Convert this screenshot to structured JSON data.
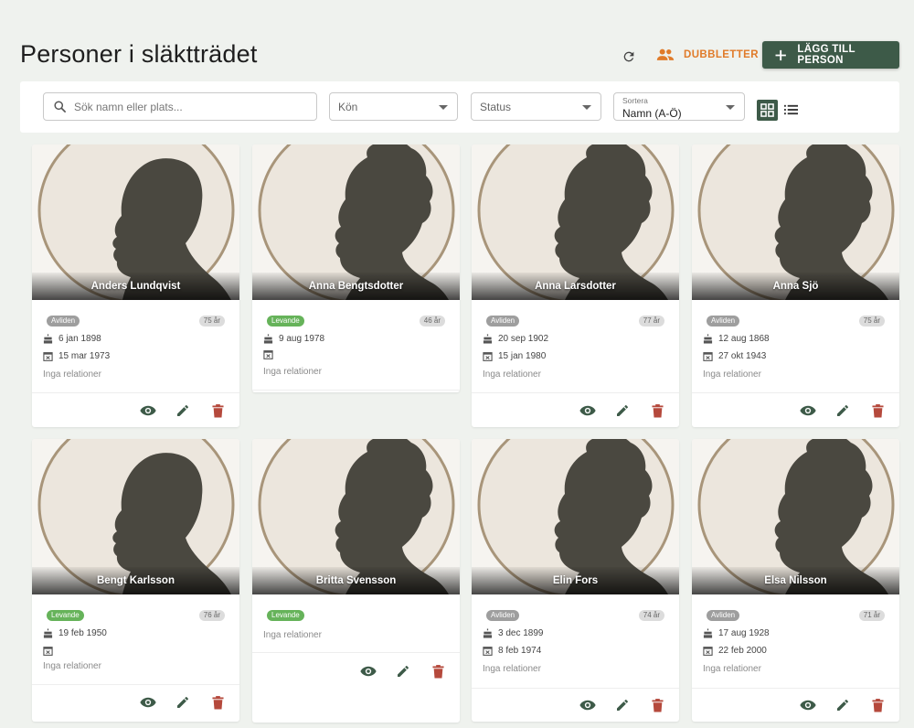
{
  "header": {
    "title": "Personer i släktträdet",
    "duplicates_label": "DUBBLETTER",
    "add_person_label": "LÄGG TILL PERSON"
  },
  "filters": {
    "search_placeholder": "Sök namn eller plats...",
    "gender_label": "Kön",
    "status_label": "Status",
    "sort_label": "Sortera",
    "sort_value": "Namn (A-Ö)"
  },
  "colors": {
    "accent": "#3d5a48",
    "duplicates": "#e07b2a",
    "alive_badge": "#66b35a",
    "deceased_badge": "#9e9e9e",
    "delete_icon": "#b5493c"
  },
  "persons": [
    {
      "name": "Anders Lundqvist",
      "status": "Avliden",
      "alive": false,
      "age": "75 år",
      "birth": "6 jan 1898",
      "death": "15 mar 1973",
      "relations": "Inga relationer",
      "silhouette": "male"
    },
    {
      "name": "Anna Bengtsdotter",
      "status": "Levande",
      "alive": true,
      "age": "46 år",
      "birth": "9 aug 1978",
      "death": "",
      "relations": "Inga relationer",
      "silhouette": "female"
    },
    {
      "name": "Anna Larsdotter",
      "status": "Avliden",
      "alive": false,
      "age": "77 år",
      "birth": "20 sep 1902",
      "death": "15 jan 1980",
      "relations": "Inga relationer",
      "silhouette": "female"
    },
    {
      "name": "Anna Sjö",
      "status": "Avliden",
      "alive": false,
      "age": "75 år",
      "birth": "12 aug 1868",
      "death": "27 okt 1943",
      "relations": "Inga relationer",
      "silhouette": "female"
    },
    {
      "name": "Bengt Karlsson",
      "status": "Levande",
      "alive": true,
      "age": "76 år",
      "birth": "19 feb 1950",
      "death": "",
      "relations": "Inga relationer",
      "silhouette": "male"
    },
    {
      "name": "Britta Svensson",
      "status": "Levande",
      "alive": true,
      "age": "",
      "birth": "",
      "death": "",
      "relations": "Inga relationer",
      "silhouette": "female"
    },
    {
      "name": "Elin Fors",
      "status": "Avliden",
      "alive": false,
      "age": "74 år",
      "birth": "3 dec 1899",
      "death": "8 feb 1974",
      "relations": "Inga relationer",
      "silhouette": "female"
    },
    {
      "name": "Elsa Nilsson",
      "status": "Avliden",
      "alive": false,
      "age": "71 år",
      "birth": "17 aug 1928",
      "death": "22 feb 2000",
      "relations": "Inga relationer",
      "silhouette": "female"
    }
  ]
}
